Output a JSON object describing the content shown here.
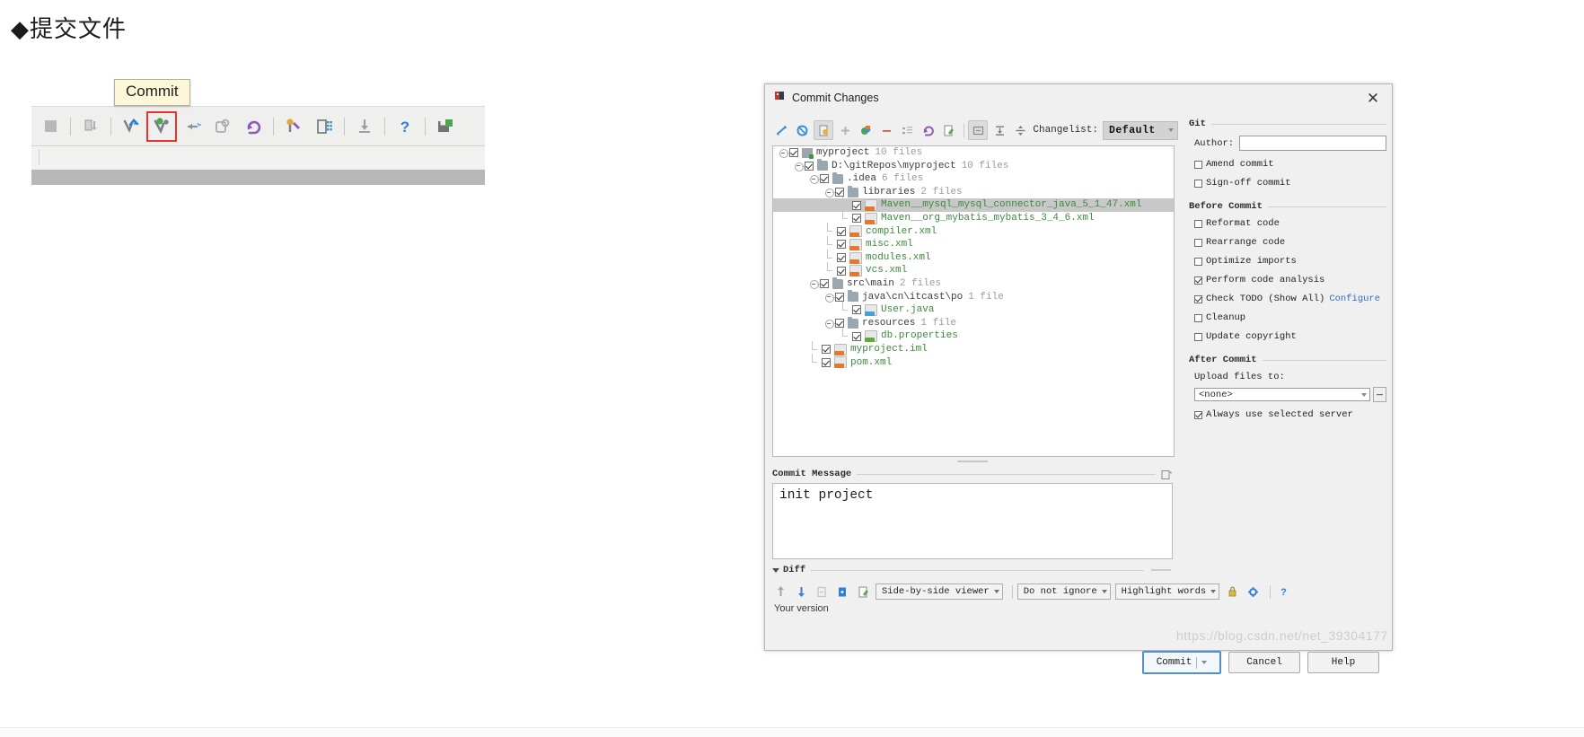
{
  "heading": "◆提交文件",
  "toolbar_shot": {
    "tooltip": "Commit",
    "buttons": [
      {
        "name": "stop-icon",
        "glyph": "■"
      },
      {
        "name": "sep",
        "glyph": ""
      },
      {
        "name": "update-project-icon",
        "glyph": "⬇"
      },
      {
        "name": "sep",
        "glyph": ""
      },
      {
        "name": "update-vcs-icon",
        "glyph": "✔"
      },
      {
        "name": "commit-icon",
        "glyph": "✔"
      },
      {
        "name": "push-icon",
        "glyph": "→"
      },
      {
        "name": "history-icon",
        "glyph": "◔"
      },
      {
        "name": "rollback-icon",
        "glyph": "↶"
      },
      {
        "name": "sep",
        "glyph": ""
      },
      {
        "name": "settings-wrench-icon",
        "glyph": "⚙"
      },
      {
        "name": "structure-icon",
        "glyph": "▦"
      },
      {
        "name": "sep",
        "glyph": ""
      },
      {
        "name": "download-icon",
        "glyph": "⤓"
      },
      {
        "name": "sep",
        "glyph": ""
      },
      {
        "name": "help-icon",
        "glyph": "?"
      },
      {
        "name": "sep",
        "glyph": ""
      },
      {
        "name": "save-all-icon",
        "glyph": "💾"
      }
    ]
  },
  "dialog": {
    "title": "Commit Changes",
    "close_label": "✕",
    "toolbar_icons": [
      "expand-all-icon",
      "refresh-icon",
      "show-diff-icon",
      "add-icon",
      "move-to-changelist-icon",
      "delete-icon",
      "group-by-icon",
      "rollback-icon",
      "edit-source-icon",
      "preview-icon",
      "collapse-icon",
      "split-icon"
    ],
    "changelist": {
      "label": "Changelist:",
      "value": "Default"
    },
    "tree": [
      {
        "indent": 0,
        "toggle": "minus",
        "checked": true,
        "icon": "folder-mod",
        "name": "myproject",
        "count": "10 files",
        "selected": false,
        "color": "dark"
      },
      {
        "indent": 1,
        "toggle": "minus",
        "checked": true,
        "icon": "folder",
        "name": "D:\\gitRepos\\myproject",
        "count": "10 files",
        "selected": false,
        "color": "dark"
      },
      {
        "indent": 2,
        "toggle": "minus",
        "checked": true,
        "icon": "folder",
        "name": ".idea",
        "count": "6 files",
        "selected": false,
        "color": "dark"
      },
      {
        "indent": 3,
        "toggle": "minus",
        "checked": true,
        "icon": "folder",
        "name": "libraries",
        "count": "2 files",
        "selected": false,
        "color": "dark"
      },
      {
        "indent": 4,
        "toggle": "elbow",
        "checked": true,
        "icon": "xml",
        "name": "Maven__mysql_mysql_connector_java_5_1_47.xml",
        "count": "",
        "selected": true,
        "color": "green"
      },
      {
        "indent": 4,
        "toggle": "elbow",
        "checked": true,
        "icon": "xml",
        "name": "Maven__org_mybatis_mybatis_3_4_6.xml",
        "count": "",
        "selected": false,
        "color": "green"
      },
      {
        "indent": 3,
        "toggle": "elbow",
        "checked": true,
        "icon": "xml",
        "name": "compiler.xml",
        "count": "",
        "selected": false,
        "color": "green"
      },
      {
        "indent": 3,
        "toggle": "elbow",
        "checked": true,
        "icon": "xml",
        "name": "misc.xml",
        "count": "",
        "selected": false,
        "color": "green"
      },
      {
        "indent": 3,
        "toggle": "elbow",
        "checked": true,
        "icon": "xml",
        "name": "modules.xml",
        "count": "",
        "selected": false,
        "color": "green"
      },
      {
        "indent": 3,
        "toggle": "elbow",
        "checked": true,
        "icon": "xml",
        "name": "vcs.xml",
        "count": "",
        "selected": false,
        "color": "green"
      },
      {
        "indent": 2,
        "toggle": "minus",
        "checked": true,
        "icon": "folder",
        "name": "src\\main",
        "count": "2 files",
        "selected": false,
        "color": "dark"
      },
      {
        "indent": 3,
        "toggle": "minus",
        "checked": true,
        "icon": "folder",
        "name": "java\\cn\\itcast\\po",
        "count": "1 file",
        "selected": false,
        "color": "dark"
      },
      {
        "indent": 4,
        "toggle": "elbow",
        "checked": true,
        "icon": "java",
        "name": "User.java",
        "count": "",
        "selected": false,
        "color": "green"
      },
      {
        "indent": 3,
        "toggle": "minus",
        "checked": true,
        "icon": "folder",
        "name": "resources",
        "count": "1 file",
        "selected": false,
        "color": "dark"
      },
      {
        "indent": 4,
        "toggle": "elbow",
        "checked": true,
        "icon": "props",
        "name": "db.properties",
        "count": "",
        "selected": false,
        "color": "green"
      },
      {
        "indent": 2,
        "toggle": "elbow",
        "checked": true,
        "icon": "xml",
        "name": "myproject.iml",
        "count": "",
        "selected": false,
        "color": "green"
      },
      {
        "indent": 2,
        "toggle": "elbow",
        "checked": true,
        "icon": "xml",
        "name": "pom.xml",
        "count": "",
        "selected": false,
        "color": "green"
      }
    ],
    "commit_message": {
      "label": "Commit Message",
      "value": "init project"
    },
    "diff": {
      "label": "Diff",
      "viewer_mode": "Side-by-side viewer",
      "ignore_mode": "Do not ignore",
      "highlight_mode": "Highlight words",
      "help_label": "?",
      "your_version": "Your version",
      "icons": [
        "previous-difference-icon",
        "next-difference-icon",
        "revert-icon",
        "apply-icon",
        "edit-source-icon",
        "lock-icon",
        "settings-icon"
      ]
    },
    "git_panel": {
      "group_label": "Git",
      "author_label": "Author:",
      "author_value": "",
      "amend_commit": {
        "label": "Amend commit",
        "checked": false
      },
      "sign_off_commit": {
        "label": "Sign-off commit",
        "checked": false
      }
    },
    "before_commit": {
      "group_label": "Before Commit",
      "items": [
        {
          "label": "Reformat code",
          "checked": false
        },
        {
          "label": "Rearrange code",
          "checked": false
        },
        {
          "label": "Optimize imports",
          "checked": false
        },
        {
          "label": "Perform code analysis",
          "checked": true
        },
        {
          "label": "Check TODO (Show All)",
          "checked": true,
          "link": "Configure"
        },
        {
          "label": "Cleanup",
          "checked": false
        },
        {
          "label": "Update copyright",
          "checked": false
        }
      ]
    },
    "after_commit": {
      "group_label": "After Commit",
      "upload_label": "Upload files to:",
      "upload_value": "<none>",
      "always_use_selected_server": {
        "label": "Always use selected server",
        "checked": true
      }
    },
    "buttons": {
      "commit": "Commit",
      "cancel": "Cancel",
      "help": "Help"
    }
  },
  "watermark": "https://blog.csdn.net/net_39304177",
  "colors": {
    "accent_blue": "#4f8fd0",
    "highlight_red": "#e8342a",
    "tree_green": "#3c8a3c",
    "tooltip_bg": "#fdf6d8",
    "link_blue": "#2f6ec4"
  }
}
